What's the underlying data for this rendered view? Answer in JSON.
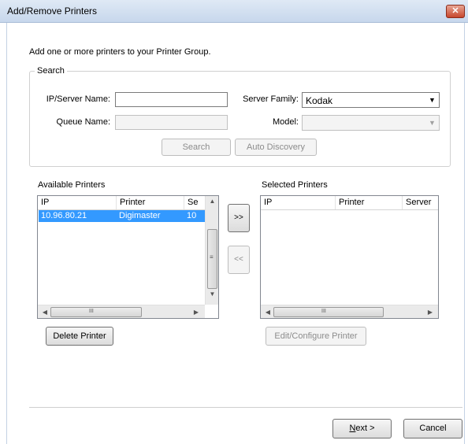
{
  "window": {
    "title": "Add/Remove Printers",
    "close_glyph": "✕"
  },
  "intro_text": "Add one or more printers to your Printer Group.",
  "search": {
    "legend": "Search",
    "ip_label": "IP/Server Name:",
    "ip_value": "",
    "queue_label": "Queue Name:",
    "queue_value": "",
    "family_label": "Server Family:",
    "family_value": "Kodak",
    "model_label": "Model:",
    "model_value": "",
    "search_button": "Search",
    "auto_discovery_button": "Auto Discovery"
  },
  "available": {
    "label": "Available Printers",
    "columns": [
      "IP",
      "Printer",
      "Se"
    ],
    "rows": [
      {
        "ip": "10.96.80.21",
        "printer": "Digimaster",
        "server": "10"
      }
    ],
    "delete_button": "Delete Printer"
  },
  "transfer": {
    "add": ">>",
    "remove": "<<"
  },
  "selected": {
    "label": "Selected Printers",
    "columns": [
      "IP",
      "Printer",
      "Server"
    ],
    "edit_button": "Edit/Configure Printer"
  },
  "footer": {
    "next_mnemonic": "N",
    "next_rest": "ext >",
    "cancel": "Cancel"
  },
  "scroll_glyphs": {
    "up": "▲",
    "down": "▼",
    "left": "◀",
    "right": "▶",
    "grip_v": "≡",
    "grip_h": "III"
  },
  "colors": {
    "selection": "#3399ff",
    "title_gradient_top": "#dfe9f5",
    "close_red": "#c7462c"
  }
}
